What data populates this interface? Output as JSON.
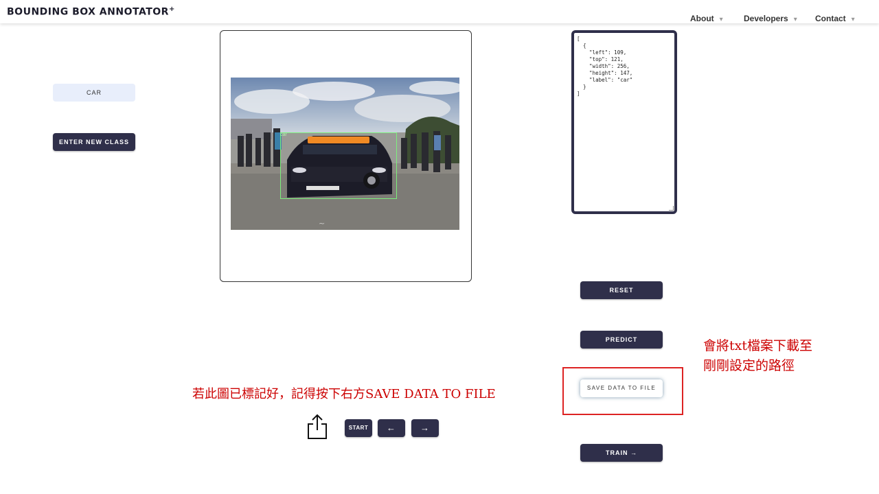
{
  "header": {
    "brand": "BOUNDING BOX ANNOTATOR",
    "brand_mark": "+",
    "nav": [
      {
        "label": "About"
      },
      {
        "label": "Developers"
      },
      {
        "label": "Contact"
      }
    ]
  },
  "left_panel": {
    "class_chip": "CAR",
    "enter_class_label": "ENTER NEW CLASS"
  },
  "canvas": {
    "bbox_label": "car"
  },
  "json_output": "[\n  {\n    \"left\": 109,\n    \"top\": 121,\n    \"width\": 256,\n    \"height\": 147,\n    \"label\": \"car\"\n  }\n]",
  "right_panel": {
    "reset_label": "RESET",
    "predict_label": "PREDICT",
    "save_label": "SAVE DATA TO FILE",
    "train_label": "TRAIN →"
  },
  "bottom_controls": {
    "share_icon": "share-icon",
    "start_label": "START",
    "prev_label": "←",
    "next_label": "→"
  },
  "annotations": {
    "left_note": "若此圖已標記好，記得按下右方SAVE DATA TO FILE",
    "right_note_line1": "會將txt檔案下載至",
    "right_note_line2": "剛剛設定的路徑"
  },
  "colors": {
    "button_bg": "#2f2f4a",
    "annotation_red": "#cc0000",
    "bbox_green": "#7cf07c"
  }
}
